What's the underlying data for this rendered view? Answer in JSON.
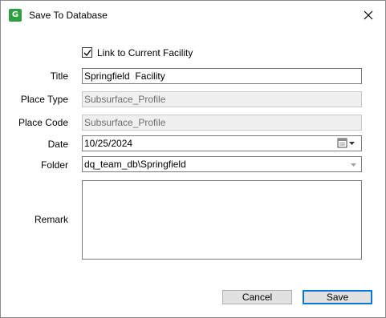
{
  "window": {
    "title": "Save To Database",
    "icon": "app-logo-icon",
    "icon_glyph": "G",
    "close_glyph": "close-icon"
  },
  "form": {
    "link_checkbox": {
      "label": "Link to Current Facility",
      "checked": true
    },
    "title": {
      "label": "Title",
      "value": "Springfield  Facility"
    },
    "place_type": {
      "label": "Place Type",
      "value": "Subsurface_Profile"
    },
    "place_code": {
      "label": "Place Code",
      "value": "Subsurface_Profile"
    },
    "date": {
      "label": "Date",
      "value": "10/25/2024"
    },
    "folder": {
      "label": "Folder",
      "value": "dq_team_db\\Springfield"
    },
    "remark": {
      "label": "Remark",
      "value": ""
    }
  },
  "buttons": {
    "cancel": "Cancel",
    "save": "Save"
  },
  "colors": {
    "accent": "#0078d7",
    "app_icon": "#2ea043",
    "readonly_bg": "#f0f0f0"
  }
}
